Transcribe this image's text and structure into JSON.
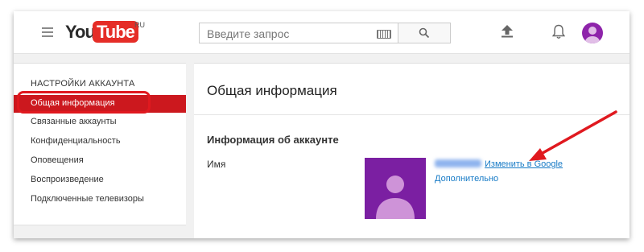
{
  "header": {
    "logo_you": "You",
    "logo_tube": "Tube",
    "logo_region": "RU",
    "search_placeholder": "Введите запрос",
    "icons": [
      "menu-icon",
      "keyboard-icon",
      "search-icon",
      "upload-icon",
      "bell-icon",
      "avatar"
    ]
  },
  "sidebar": {
    "heading": "НАСТРОЙКИ АККАУНТА",
    "items": [
      {
        "label": "Общая информация",
        "active": true
      },
      {
        "label": "Связанные аккаунты",
        "active": false
      },
      {
        "label": "Конфиденциальность",
        "active": false
      },
      {
        "label": "Оповещения",
        "active": false
      },
      {
        "label": "Воспроизведение",
        "active": false
      },
      {
        "label": "Подключенные телевизоры",
        "active": false
      }
    ]
  },
  "main": {
    "title": "Общая информация",
    "section_title": "Информация об аккаунте",
    "name_label": "Имя",
    "change_link": "Изменить в Google",
    "more_link": "Дополнительно"
  },
  "colors": {
    "brand_red": "#e52d27",
    "active_item": "#cc181e",
    "annotation_red": "#e0191f",
    "link_blue": "#167ac6",
    "avatar_purple": "#7b1fa2"
  }
}
